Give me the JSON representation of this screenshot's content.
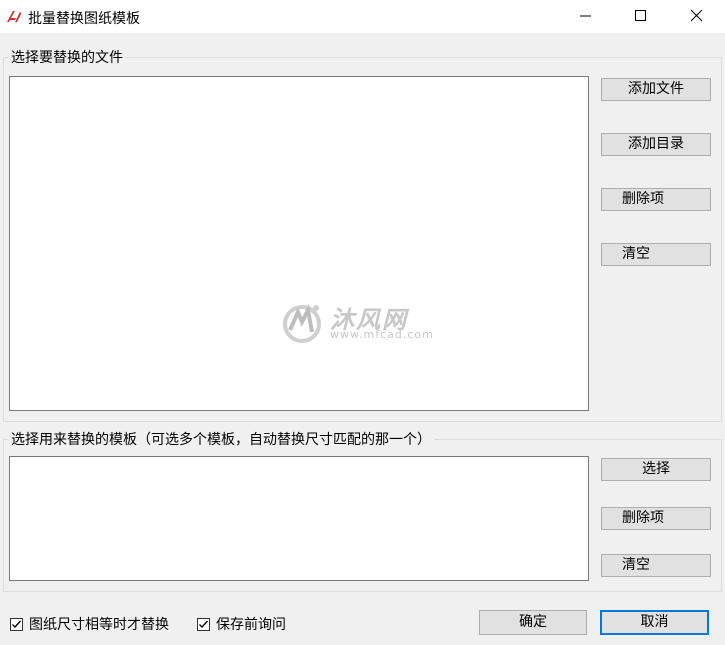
{
  "window": {
    "title": "批量替换图纸模板",
    "minimize_icon": "minimize-icon",
    "maximize_icon": "maximize-icon",
    "close_icon": "close-icon"
  },
  "files_group": {
    "label": "选择要替换的文件",
    "items": [],
    "buttons": {
      "add_file": "添加文件",
      "add_directory": "添加目录",
      "delete_item": "删除项",
      "clear": "清空"
    }
  },
  "templates_group": {
    "label": "选择用来替换的模板（可选多个模板，自动替换尺寸匹配的那一个）",
    "items": [],
    "buttons": {
      "select": "选择",
      "delete_item": "删除项",
      "clear": "清空"
    }
  },
  "options": {
    "replace_equal_size": {
      "label": "图纸尺寸相等时才替换",
      "checked": true
    },
    "ask_before_save": {
      "label": "保存前询问",
      "checked": true
    }
  },
  "footer": {
    "ok": "确定",
    "cancel": "取消"
  },
  "watermark": {
    "brand": "沐风网",
    "url": "www.mfcad.com"
  },
  "colors": {
    "accent": "#0078d7",
    "app_icon": "#d32f2f"
  }
}
